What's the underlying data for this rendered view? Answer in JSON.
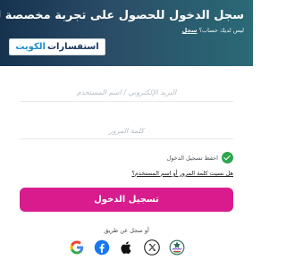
{
  "hero": {
    "title": "سجل الدخول للحصول على تجربة مخصصة لك",
    "subtitle_prefix": "ليس لديك حساب؟",
    "register_link": "سجل"
  },
  "brand": {
    "main": "استفسارات",
    "accent": "الكويت"
  },
  "form": {
    "email_placeholder": "البريد الإلكتروني / اسم المستخدم",
    "password_placeholder": "كلمة المرور",
    "remember_label": "احفظ تسجيل الدخول",
    "forgot_link": "هل نسيت كلمة المرور أو اسم المستخدم؟",
    "login_button": "تسجيل الدخول"
  },
  "social": {
    "or_text": "أو سجل عن طريق",
    "providers": [
      "google-icon",
      "facebook-icon",
      "apple-icon",
      "x-icon",
      "kuwait-seal-icon"
    ]
  },
  "colors": {
    "header_start": "#16324f",
    "header_end": "#2a6a76",
    "button": "#d91c8d",
    "check": "#2ea44f",
    "brand_text": "#17365b",
    "brand_accent": "#1e8ec8"
  }
}
